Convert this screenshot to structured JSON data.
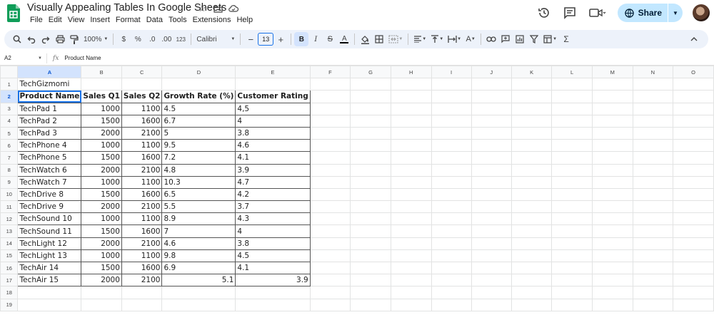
{
  "app": {
    "doc_title": "Visually Appealing Tables In Google Sheets",
    "menu": [
      "File",
      "Edit",
      "View",
      "Insert",
      "Format",
      "Data",
      "Tools",
      "Extensions",
      "Help"
    ],
    "share_label": "Share",
    "accent_color": "#1a73e8",
    "share_color": "#c2e7ff"
  },
  "toolbar": {
    "zoom": "100%",
    "currency": "$",
    "percent": "%",
    "decrease_decimal": ".0",
    "increase_decimal": ".00",
    "more_formats": "123",
    "font_name": "Calibri",
    "font_size": "13",
    "bold": "B",
    "italic": "I",
    "text_color": "A",
    "sigma": "Σ"
  },
  "formula_bar": {
    "cell_ref": "A2",
    "fx": "fx",
    "content": "Product Name"
  },
  "grid": {
    "columns": [
      "A",
      "B",
      "C",
      "D",
      "E",
      "F",
      "G",
      "H",
      "I",
      "J",
      "K",
      "L",
      "M",
      "N",
      "O"
    ],
    "row_numbers": [
      "1",
      "2",
      "3",
      "4",
      "5",
      "6",
      "7",
      "8",
      "9",
      "10",
      "11",
      "12",
      "13",
      "14",
      "15",
      "16",
      "17",
      "18",
      "19"
    ],
    "title_cell": "TechGizmomi",
    "headers": [
      "Product Name",
      "Sales Q1",
      "Sales Q2",
      "Growth Rate (%)",
      "Customer Rating"
    ],
    "rows": [
      [
        "TechPad 1",
        "1000",
        "1100",
        "4.5",
        "4,5"
      ],
      [
        "TechPad 2",
        "1500",
        "1600",
        "6.7",
        "4"
      ],
      [
        "TechPad 3",
        "2000",
        "2100",
        "5",
        "3.8"
      ],
      [
        "TechPhone 4",
        "1000",
        "1100",
        "9.5",
        "4.6"
      ],
      [
        "TechPhone 5",
        "1500",
        "1600",
        "7.2",
        "4.1"
      ],
      [
        "TechWatch 6",
        "2000",
        "2100",
        "4.8",
        "3.9"
      ],
      [
        "TechWatch 7",
        "1000",
        "1100",
        "10.3",
        "4.7"
      ],
      [
        "TechDrive 8",
        "1500",
        "1600",
        "6.5",
        "4.2"
      ],
      [
        "TechDrive 9",
        "2000",
        "2100",
        "5.5",
        "3.7"
      ],
      [
        "TechSound 10",
        "1000",
        "1100",
        "8.9",
        "4.3"
      ],
      [
        "TechSound 11",
        "1500",
        "1600",
        "7",
        "4"
      ],
      [
        "TechLight 12",
        "2000",
        "2100",
        "4.6",
        "3.8"
      ],
      [
        "TechLight 13",
        "1000",
        "1100",
        "9.8",
        "4.5"
      ],
      [
        "TechAir 14",
        "1500",
        "1600",
        "6.9",
        "4.1"
      ],
      [
        "TechAir 15",
        "2000",
        "2100",
        "5.1",
        "3.9"
      ]
    ]
  }
}
